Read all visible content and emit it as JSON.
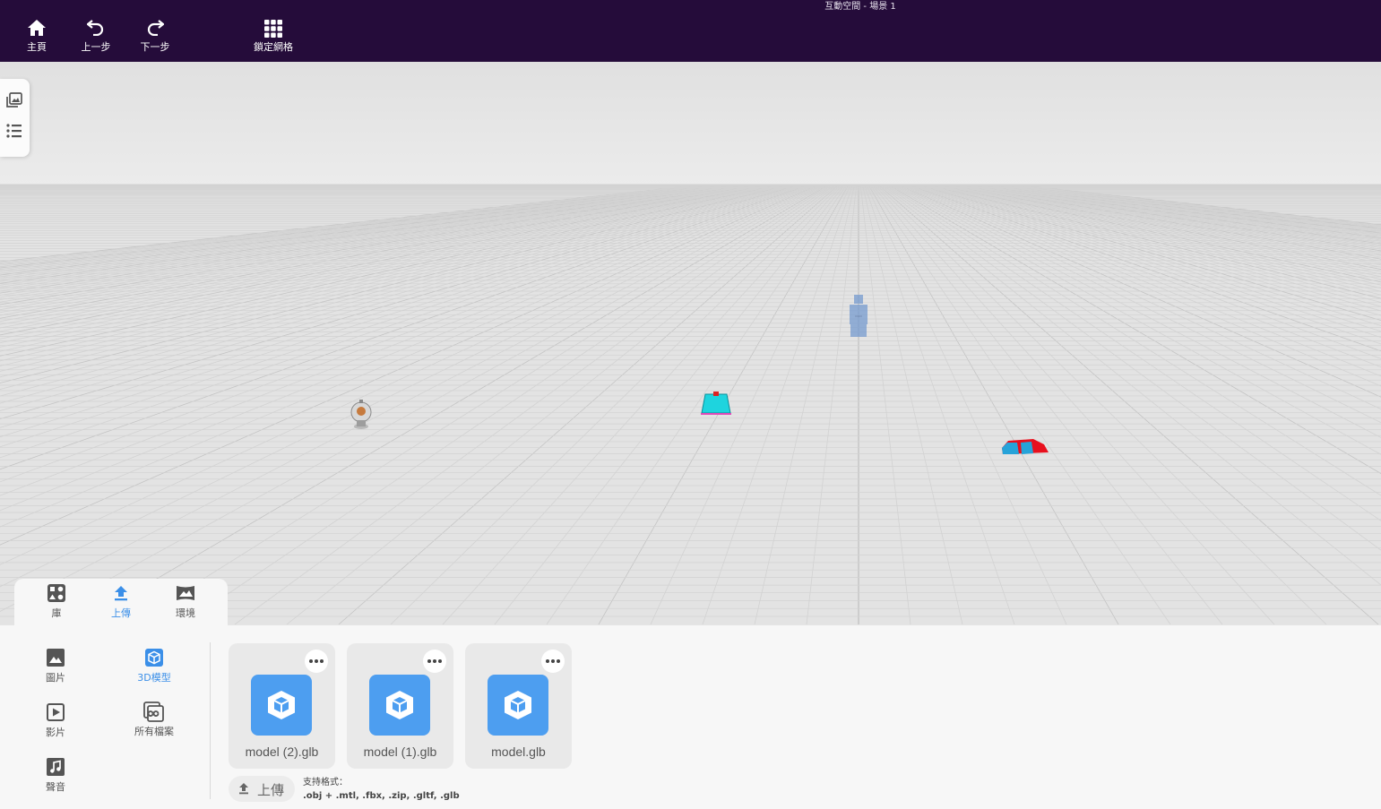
{
  "window": {
    "title": "互動空間 - 場景 1"
  },
  "toolbar": {
    "home": "主頁",
    "undo": "上一步",
    "redo": "下一步",
    "lock_grid": "鎖定網格"
  },
  "tabs": [
    {
      "label": "庫",
      "icon": "library-icon"
    },
    {
      "label": "上傳",
      "icon": "upload-icon",
      "active": true
    },
    {
      "label": "環境",
      "icon": "environment-icon"
    }
  ],
  "categories": [
    {
      "label": "圖片",
      "icon": "image-icon"
    },
    {
      "label": "3D模型",
      "icon": "cube-icon",
      "active": true
    },
    {
      "label": "影片",
      "icon": "video-icon"
    },
    {
      "label": "所有檔案",
      "icon": "all-files-icon"
    },
    {
      "label": "聲音",
      "icon": "music-icon"
    }
  ],
  "files": [
    {
      "name": "model (2).glb"
    },
    {
      "name": "model (1).glb"
    },
    {
      "name": "model.glb"
    }
  ],
  "upload": {
    "label": "上傳",
    "formats_label": "支持格式：",
    "formats": ".obj + .mtl, .fbx, .zip, .gltf, .glb"
  },
  "colors": {
    "topbar": "#250c3a",
    "accent": "#3b8fe8",
    "card_thumb": "#4d9ef0"
  }
}
